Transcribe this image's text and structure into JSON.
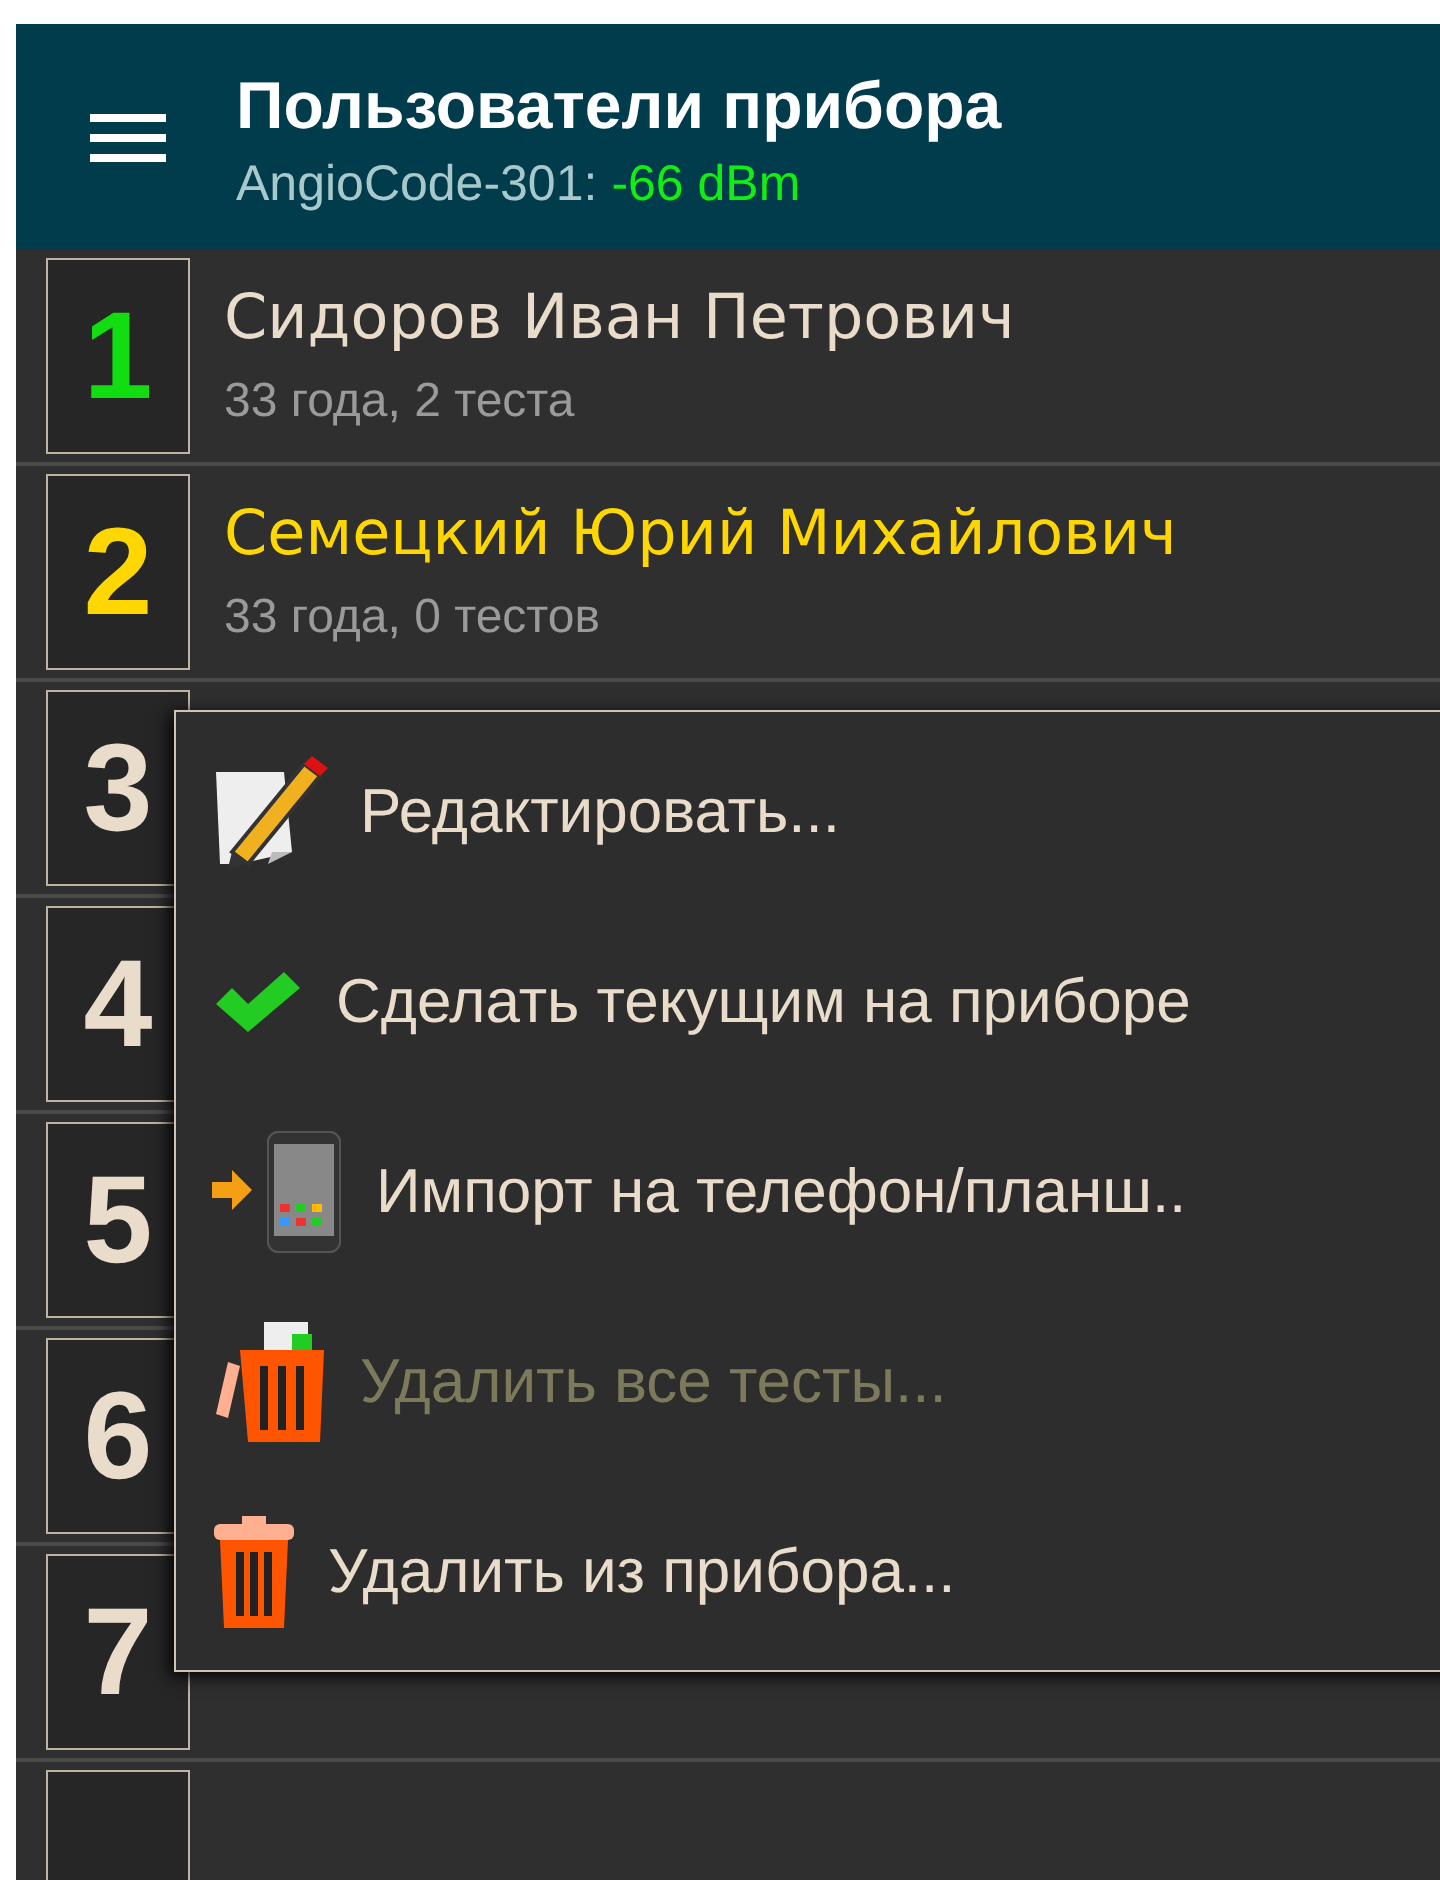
{
  "app_bar": {
    "title": "Пользователи прибора",
    "device": "AngioCode-301:",
    "signal": "-66 dBm"
  },
  "users": [
    {
      "number": "1",
      "color": "#11dd11",
      "name": "Сидоров Иван Петрович",
      "details": "33 года, 2 теста",
      "current": false
    },
    {
      "number": "2",
      "color": "#ffd700",
      "name": "Семецкий Юрий Михайлович",
      "details": "33 года, 0 тестов",
      "current": true
    },
    {
      "number": "3",
      "color": "#eadccb"
    },
    {
      "number": "4",
      "color": "#eadccb"
    },
    {
      "number": "5",
      "color": "#eadccb"
    },
    {
      "number": "6",
      "color": "#eadccb"
    },
    {
      "number": "7",
      "color": "#eadccb"
    }
  ],
  "context_menu": [
    {
      "kind": "edit",
      "label": "Редактировать...",
      "disabled": false
    },
    {
      "kind": "check",
      "label": "Сделать текущим на приборе",
      "disabled": false
    },
    {
      "kind": "phone",
      "label": "Импорт на телефон/планш..",
      "disabled": false
    },
    {
      "kind": "trash-tests",
      "label": "Удалить все тесты...",
      "disabled": true
    },
    {
      "kind": "trash",
      "label": "Удалить из прибора...",
      "disabled": false
    }
  ]
}
